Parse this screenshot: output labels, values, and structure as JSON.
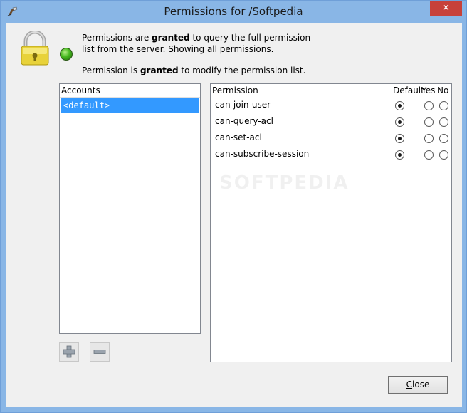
{
  "window": {
    "title": "Permissions for /Softpedia",
    "close_glyph": "✕"
  },
  "status": {
    "query_prefix": "Permissions are ",
    "query_bold": "granted",
    "query_suffix": " to query the full permission list from the server. Showing all permissions.",
    "modify_prefix": "Permission is ",
    "modify_bold": "granted",
    "modify_suffix": " to modify the permission list.",
    "led_color": "#46b81f"
  },
  "accounts": {
    "header": "Accounts",
    "items": [
      "<default>"
    ],
    "selected": 0
  },
  "permissions": {
    "headers": {
      "permission": "Permission",
      "default": "Default",
      "yes": "Yes",
      "no": "No"
    },
    "rows": [
      {
        "name": "can-join-user",
        "state": "default"
      },
      {
        "name": "can-query-acl",
        "state": "default"
      },
      {
        "name": "can-set-acl",
        "state": "default"
      },
      {
        "name": "can-subscribe-session",
        "state": "default"
      }
    ]
  },
  "watermark": "SOFTPEDIA",
  "buttons": {
    "add_icon": "plus-icon",
    "remove_icon": "minus-icon",
    "close_label_first": "C",
    "close_label_rest": "lose"
  },
  "colors": {
    "selection": "#3399ff",
    "title_bar": "#89b6e6",
    "close_x": "#c7413a"
  }
}
